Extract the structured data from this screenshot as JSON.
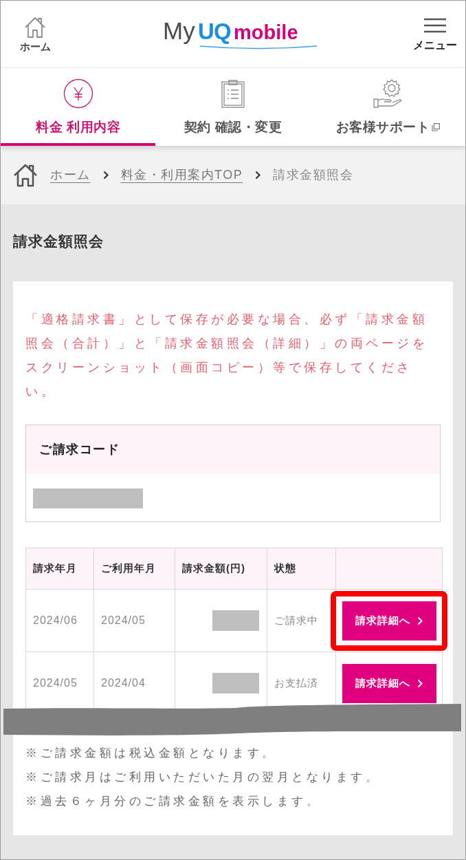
{
  "header": {
    "home_label": "ホーム",
    "logo": {
      "prefix": "My",
      "brand": "UQ",
      "suffix": "mobile"
    },
    "menu_label": "メニュー"
  },
  "tabs": [
    {
      "label": "料金 利用内容",
      "selected": true,
      "external": false
    },
    {
      "label": "契約 確認・変更",
      "selected": false,
      "external": false
    },
    {
      "label": "お客様サポート",
      "selected": false,
      "external": true
    }
  ],
  "breadcrumb": [
    {
      "label": "ホーム",
      "link": true
    },
    {
      "label": "料金・利用案内TOP",
      "link": true
    },
    {
      "label": "請求金額照会",
      "link": false
    }
  ],
  "page_title": "請求金額照会",
  "notice": "「適格請求書」として保存が必要な場合、必ず「請求金額照会（合計）」と「請求金額照会（詳細）」の両ページをスクリーンショット（画面コピー）等で保存してください。",
  "billing_code": {
    "title": "ご請求コード",
    "redacted": true
  },
  "table": {
    "columns": [
      "請求年月",
      "ご利用年月",
      "請求金額(円)",
      "状態"
    ],
    "rows": [
      {
        "billing_month": "2024/06",
        "usage_month": "2024/05",
        "amount_redacted": true,
        "status": "ご請求中",
        "button": "請求詳細へ",
        "highlighted": true
      },
      {
        "billing_month": "2024/05",
        "usage_month": "2024/04",
        "amount_redacted": true,
        "status": "お支払済",
        "button": "請求詳細へ",
        "highlighted": false
      }
    ]
  },
  "notes": [
    "※ご請求金額は税込金額となります。",
    "※ご請求月はご利用いただいた月の翌月となります。",
    "※過去６ヶ月分のご請求金額を表示します。"
  ]
}
